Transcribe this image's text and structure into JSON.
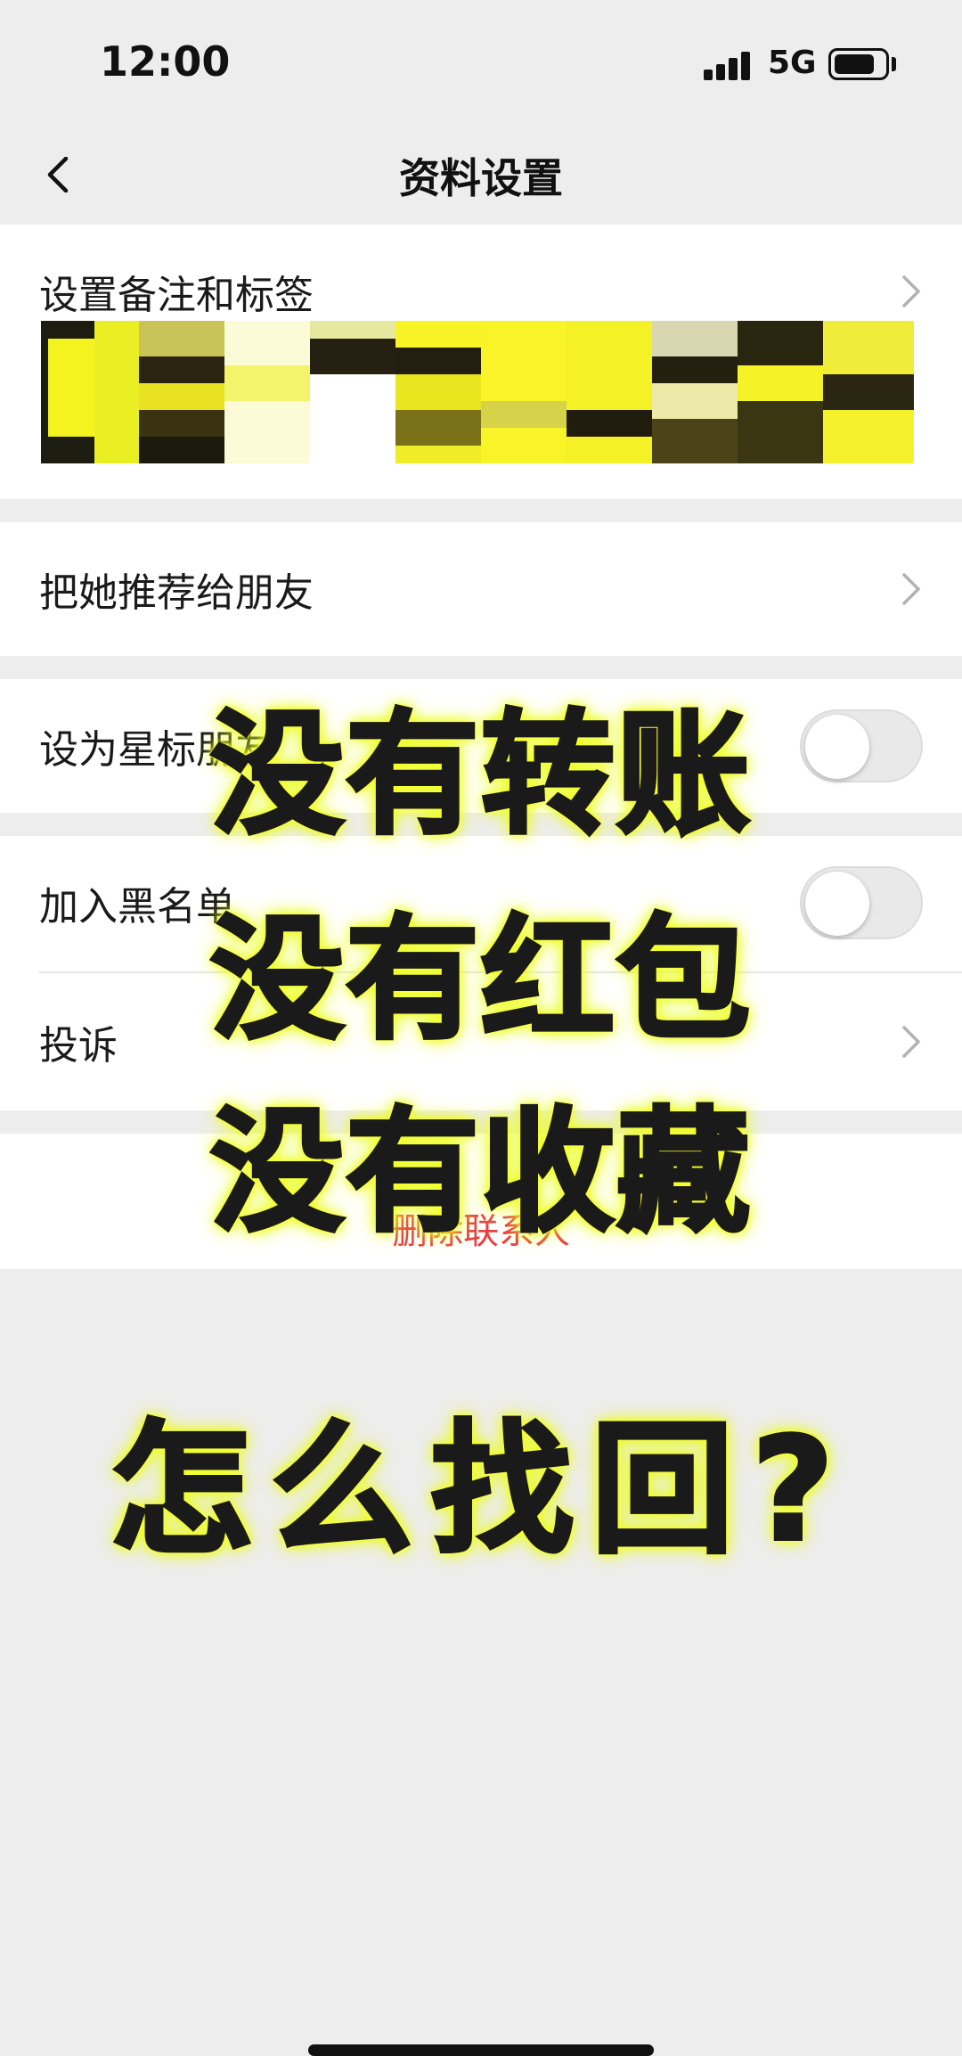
{
  "status_bar": {
    "time": "12:00",
    "network": "5G"
  },
  "nav": {
    "title": "资料设置"
  },
  "rows": {
    "remark": "设置备注和标签",
    "recommend": "把她推荐给朋友",
    "star": "设为星标朋友",
    "blacklist": "加入黑名单",
    "complain": "投诉",
    "delete": "删除联系人"
  },
  "toggles": {
    "star_on": false,
    "blacklist_on": false
  },
  "overlay": {
    "line1": "没有转账",
    "line2": "没有红包",
    "line3": "没有收藏",
    "question": "怎么找回?"
  },
  "colors": {
    "overlay_glow": "#fbff28",
    "delete_red": "#e64340",
    "background": "#ededed"
  }
}
